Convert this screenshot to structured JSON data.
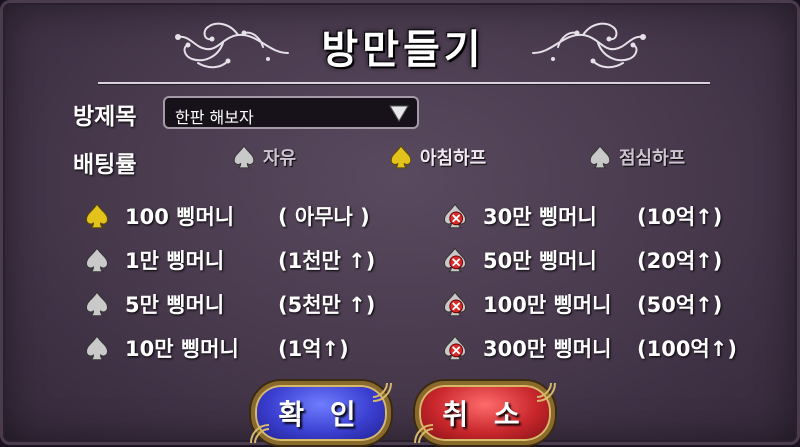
{
  "title": "방만들기",
  "room_title": {
    "label": "방제목",
    "value": "한판 해보자",
    "icon": "chevron-down-icon"
  },
  "betting_rate": {
    "label": "배팅률",
    "options": [
      {
        "label": "자유",
        "icon": "spade-icon",
        "color": "#c9c9c9",
        "selected": false
      },
      {
        "label": "아침하프",
        "icon": "spade-icon",
        "color": "#e2c21b",
        "selected": true
      },
      {
        "label": "점심하프",
        "icon": "spade-icon",
        "color": "#c9c9c9",
        "selected": false
      }
    ]
  },
  "stakes": [
    {
      "amount": "100 삥머니",
      "condition": "( 아무나 )",
      "icon": "gold-spade-icon",
      "color": "#e2c21b"
    },
    {
      "amount": "1만 삥머니",
      "condition": "(1천만 ↑)",
      "icon": "spade-icon",
      "color": "#c9c9c9"
    },
    {
      "amount": "5만 삥머니",
      "condition": "(5천만 ↑)",
      "icon": "spade-icon",
      "color": "#c9c9c9"
    },
    {
      "amount": "10만 삥머니",
      "condition": "(1억↑)",
      "icon": "spade-icon",
      "color": "#c9c9c9"
    },
    {
      "amount": "30만 삥머니",
      "condition": "(10억↑)",
      "icon": "locked-spade-icon",
      "color": "#c9c9c9"
    },
    {
      "amount": "50만 삥머니",
      "condition": "(20억↑)",
      "icon": "locked-spade-icon",
      "color": "#c9c9c9"
    },
    {
      "amount": "100만 삥머니",
      "condition": "(50억↑)",
      "icon": "locked-spade-icon",
      "color": "#c9c9c9"
    },
    {
      "amount": "300만 삥머니",
      "condition": "(100억↑)",
      "icon": "locked-spade-icon",
      "color": "#c9c9c9"
    }
  ],
  "buttons": {
    "confirm": "확 인",
    "cancel": "취 소"
  },
  "colors": {
    "confirm": "#3b3fd0",
    "cancel": "#c8272c",
    "gold": "#e2c21b"
  }
}
